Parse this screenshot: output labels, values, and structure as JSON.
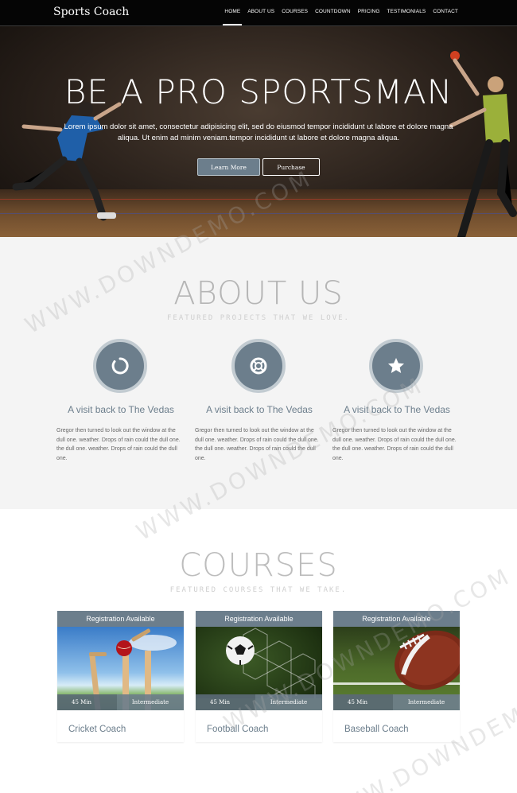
{
  "nav": {
    "brand": "Sports Coach",
    "items": [
      {
        "label": "HOME"
      },
      {
        "label": "ABOUT US"
      },
      {
        "label": "COURSES"
      },
      {
        "label": "COUNTDOWN"
      },
      {
        "label": "PRICING"
      },
      {
        "label": "TESTIMONIALS"
      },
      {
        "label": "CONTACT"
      }
    ]
  },
  "hero": {
    "title": "BE A PRO SPORTSMAN",
    "text": "Lorem ipsum dolor sit amet, consectetur adipisicing elit, sed do eiusmod tempor incididunt ut labore et dolore magna aliqua. Ut enim ad minim veniam.tempor incididunt ut labore et dolore magna aliqua.",
    "learn_more": "Learn More",
    "purchase": "Purchase"
  },
  "about": {
    "title": "ABOUT US",
    "subtitle": "FEATURED PROJECTS THAT WE LOVE.",
    "features": [
      {
        "icon": "spinner-icon",
        "heading": "A visit back to The Vedas",
        "text": "Gregor then turned to look out the window at the dull one. weather. Drops of rain could the dull one. the dull one. weather. Drops of rain could the dull one."
      },
      {
        "icon": "lifebuoy-icon",
        "heading": "A visit back to The Vedas",
        "text": "Gregor then turned to look out the window at the dull one. weather. Drops of rain could the dull one. the dull one. weather. Drops of rain could the dull one."
      },
      {
        "icon": "star-icon",
        "heading": "A visit back to The Vedas",
        "text": "Gregor then turned to look out the window at the dull one. weather. Drops of rain could the dull one. the dull one. weather. Drops of rain could the dull one."
      }
    ]
  },
  "courses": {
    "title": "COURSES",
    "subtitle": "FEATURED COURSES THAT WE TAKE.",
    "cards": [
      {
        "badge": "Registration Available",
        "duration": "45 Min",
        "level": "Intermediate",
        "title": "Cricket Coach"
      },
      {
        "badge": "Registration Available",
        "duration": "45 Min",
        "level": "Intermediate",
        "title": "Football Coach"
      },
      {
        "badge": "Registration Available",
        "duration": "45 Min",
        "level": "Intermediate",
        "title": "Baseball Coach"
      }
    ]
  },
  "watermark": "WWW.DOWNDEMO.COM",
  "colors": {
    "accent": "#6c7e8c",
    "nav_bg": "#050505",
    "about_bg": "#f4f4f4"
  }
}
